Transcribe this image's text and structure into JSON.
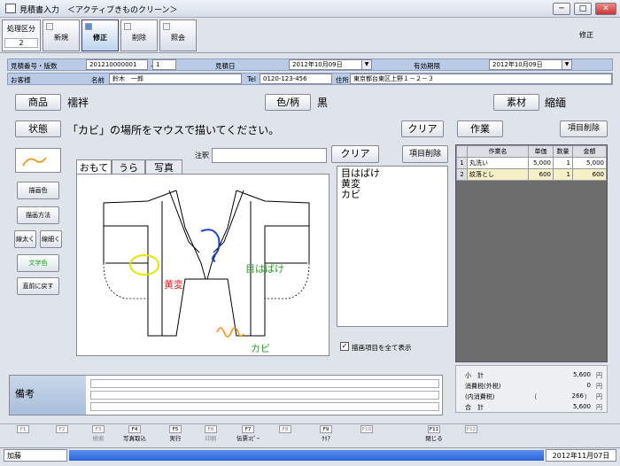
{
  "window": {
    "title": "見積書入力　＜アクティブきものクリーン＞"
  },
  "mode": {
    "label": "処理区分",
    "value": "2",
    "current": "修正"
  },
  "toolbar": {
    "buttons": [
      {
        "label": "新規"
      },
      {
        "label": "修正"
      },
      {
        "label": "削除"
      },
      {
        "label": "照会"
      }
    ]
  },
  "header": {
    "estimate_label": "見積番号・版数",
    "estimate_no": "201210000001",
    "dash": "－",
    "version": "1",
    "date_label": "見積日",
    "date": "2012年10月09日",
    "valid_label": "有効期限",
    "valid_date": "2012年10月09日",
    "customer_label": "お客様",
    "name_label": "名前",
    "name": "鈴木　一郎",
    "tel_label": "Tel",
    "tel": "0120-123-456",
    "addr_label": "住所",
    "address": "東京都台東区上野１－２－３"
  },
  "item": {
    "product_label": "商品",
    "product": "襦袢",
    "color_label": "色/柄",
    "color": "黒",
    "material_label": "素材",
    "material": "縮緬"
  },
  "state": {
    "label": "状態",
    "instruction": "「カビ」の場所をマウスで描いてください。",
    "clear": "クリア"
  },
  "work": {
    "label": "作業",
    "delete_item": "項目削除",
    "headers": [
      "",
      "作業名",
      "単価",
      "数量",
      "金額"
    ],
    "rows": [
      {
        "no": "1",
        "name": "丸洗い",
        "price": "5,000",
        "qty": "1",
        "amount": "5,000"
      },
      {
        "no": "2",
        "name": "紋落とし",
        "price": "600",
        "qty": "1",
        "amount": "600"
      }
    ]
  },
  "tools": {
    "color": "描画色",
    "method": "描画方法",
    "thicker": "線太く",
    "thinner": "線細く",
    "textcolor": "文字色",
    "undo": "直前に戻す"
  },
  "tabs": {
    "front": "おもて",
    "back": "うら",
    "photo": "写真"
  },
  "annotation": {
    "label": "注釈",
    "value": "",
    "clear": "クリア",
    "delete": "項目削除"
  },
  "marks": [
    "目はばけ",
    "黄変",
    "カビ"
  ],
  "drawing_labels": {
    "a": "目はばけ",
    "b": "黄変",
    "c": "カビ"
  },
  "show_all": "描画項目を全て表示",
  "totals": {
    "subtotal_label": "小　計",
    "subtotal": "5,600",
    "tax_label": "消費税(外税)",
    "tax": "0",
    "inner_label": "(内消費税)",
    "inner_open": "（",
    "inner": "266",
    "inner_close": "）",
    "total_label": "合　計",
    "total": "5,600",
    "unit": "円"
  },
  "memo": {
    "label": "備考"
  },
  "fkeys": [
    {
      "k": "F1",
      "l": ""
    },
    {
      "k": "F2",
      "l": ""
    },
    {
      "k": "F3",
      "l": "検索"
    },
    {
      "k": "F4",
      "l": "写真取込"
    },
    {
      "k": "F5",
      "l": "実行"
    },
    {
      "k": "F6",
      "l": "印刷"
    },
    {
      "k": "F7",
      "l": "伝票ｺﾋﾟｰ"
    },
    {
      "k": "F8",
      "l": ""
    },
    {
      "k": "F9",
      "l": "ｸﾘｱ"
    },
    {
      "k": "F10",
      "l": ""
    },
    {
      "k": "F11",
      "l": "閉じる"
    },
    {
      "k": "F12",
      "l": ""
    }
  ],
  "status": {
    "user": "加藤",
    "date": "2012年11月07日"
  }
}
